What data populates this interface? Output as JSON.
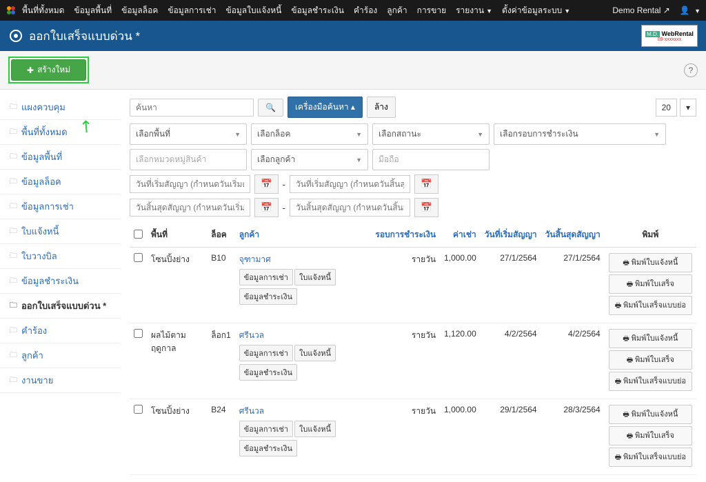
{
  "topbar": {
    "menu": [
      "พื้นที่ทั้งหมด",
      "ข้อมูลพื้นที่",
      "ข้อมูลล็อค",
      "ข้อมูลการเช่า",
      "ข้อมูลใบแจ้งหนี้",
      "ข้อมูลชำระเงิน",
      "คำร้อง",
      "ลูกค้า",
      "การขาย",
      "รายงาน",
      "ตั้งค่าข้อมูลระบบ"
    ],
    "menu_caret": [
      false,
      false,
      false,
      false,
      false,
      false,
      false,
      false,
      false,
      true,
      true
    ],
    "demo": "Demo Rental",
    "user": ""
  },
  "header": {
    "title": "ออกใบเสร็จแบบด่วน *",
    "logo_top": "M.D.",
    "logo_main": "WebRental"
  },
  "toolbar": {
    "new_label": "สร้างใหม่"
  },
  "sidebar": {
    "items": [
      {
        "label": "แผงควบคุม"
      },
      {
        "label": "พื้นที่ทั้งหมด"
      },
      {
        "label": "ข้อมูลพื้นที่"
      },
      {
        "label": "ข้อมูลล็อค"
      },
      {
        "label": "ข้อมูลการเช่า"
      },
      {
        "label": "ใบแจ้งหนี้"
      },
      {
        "label": "ใบวางบิล"
      },
      {
        "label": "ข้อมูลชำระเงิน"
      },
      {
        "label": "ออกใบเสร็จแบบด่วน *",
        "active": true
      },
      {
        "label": "คำร้อง"
      },
      {
        "label": "ลูกค้า"
      },
      {
        "label": "งานขาย"
      }
    ]
  },
  "search": {
    "placeholder": "ค้นหา",
    "tools": "เครื่องมือค้นหา",
    "clear": "ล้าง",
    "per_page": "20"
  },
  "filters": {
    "area": "เลือกพื้นที่",
    "lock": "เลือกล็อค",
    "status": "เลือกสถานะ",
    "round": "เลือกรอบการชำระเงิน",
    "category": "เลือกหมวดหมู่สินค้า",
    "customer": "เลือกลูกค้า",
    "mobile": "มือถือ",
    "start_from": "วันที่เริ่มสัญญา (กำหนดวันเริ่มต้น)",
    "start_to": "วันที่เริ่มสัญญา (กำหนดวันสิ้นสุด)",
    "end_from": "วันสิ้นสุดสัญญา (กำหนดวันเริ่มต้น)",
    "end_to": "วันสิ้นสุดสัญญา (กำหนดวันสิ้นสุด)"
  },
  "table": {
    "headers": {
      "area": "พื้นที่",
      "lock": "ล็อค",
      "customer": "ลูกค้า",
      "round": "รอบการชำระเงิน",
      "rent": "ค่าเช่า",
      "start": "วันที่เริ่มสัญญา",
      "end": "วันสิ้นสุดสัญญา",
      "print": "พิมพ์"
    },
    "tags": {
      "rental": "ข้อมูลการเช่า",
      "invoice": "ใบแจ้งหนี้",
      "payment": "ข้อมูลชำระเงิน"
    },
    "actions": {
      "print_invoice": "พิมพ์ใบแจ้งหนี้",
      "print_receipt": "พิมพ์ใบเสร็จ",
      "print_receipt_short": "พิมพ์ใบเสร็จแบบย่อ"
    },
    "rows": [
      {
        "area": "โซนปิ้งย่าง",
        "lock": "B10",
        "customer": "จุฑามาศ",
        "round": "รายวัน",
        "rent": "1,000.00",
        "start": "27/1/2564",
        "end": "27/1/2564",
        "tags": [
          "rental",
          "invoice",
          "payment"
        ]
      },
      {
        "area": "ผลไม้ตามฤดูกาล",
        "lock": "ล็อก1",
        "customer": "ศรีนวล",
        "round": "รายวัน",
        "rent": "1,120.00",
        "start": "4/2/2564",
        "end": "4/2/2564",
        "tags": [
          "rental",
          "invoice",
          "payment"
        ]
      },
      {
        "area": "โซนปิ้งย่าง",
        "lock": "B24",
        "customer": "ศรีนวล",
        "round": "รายวัน",
        "rent": "1,000.00",
        "start": "29/1/2564",
        "end": "28/3/2564",
        "tags": [
          "rental",
          "invoice",
          "payment"
        ]
      }
    ]
  }
}
